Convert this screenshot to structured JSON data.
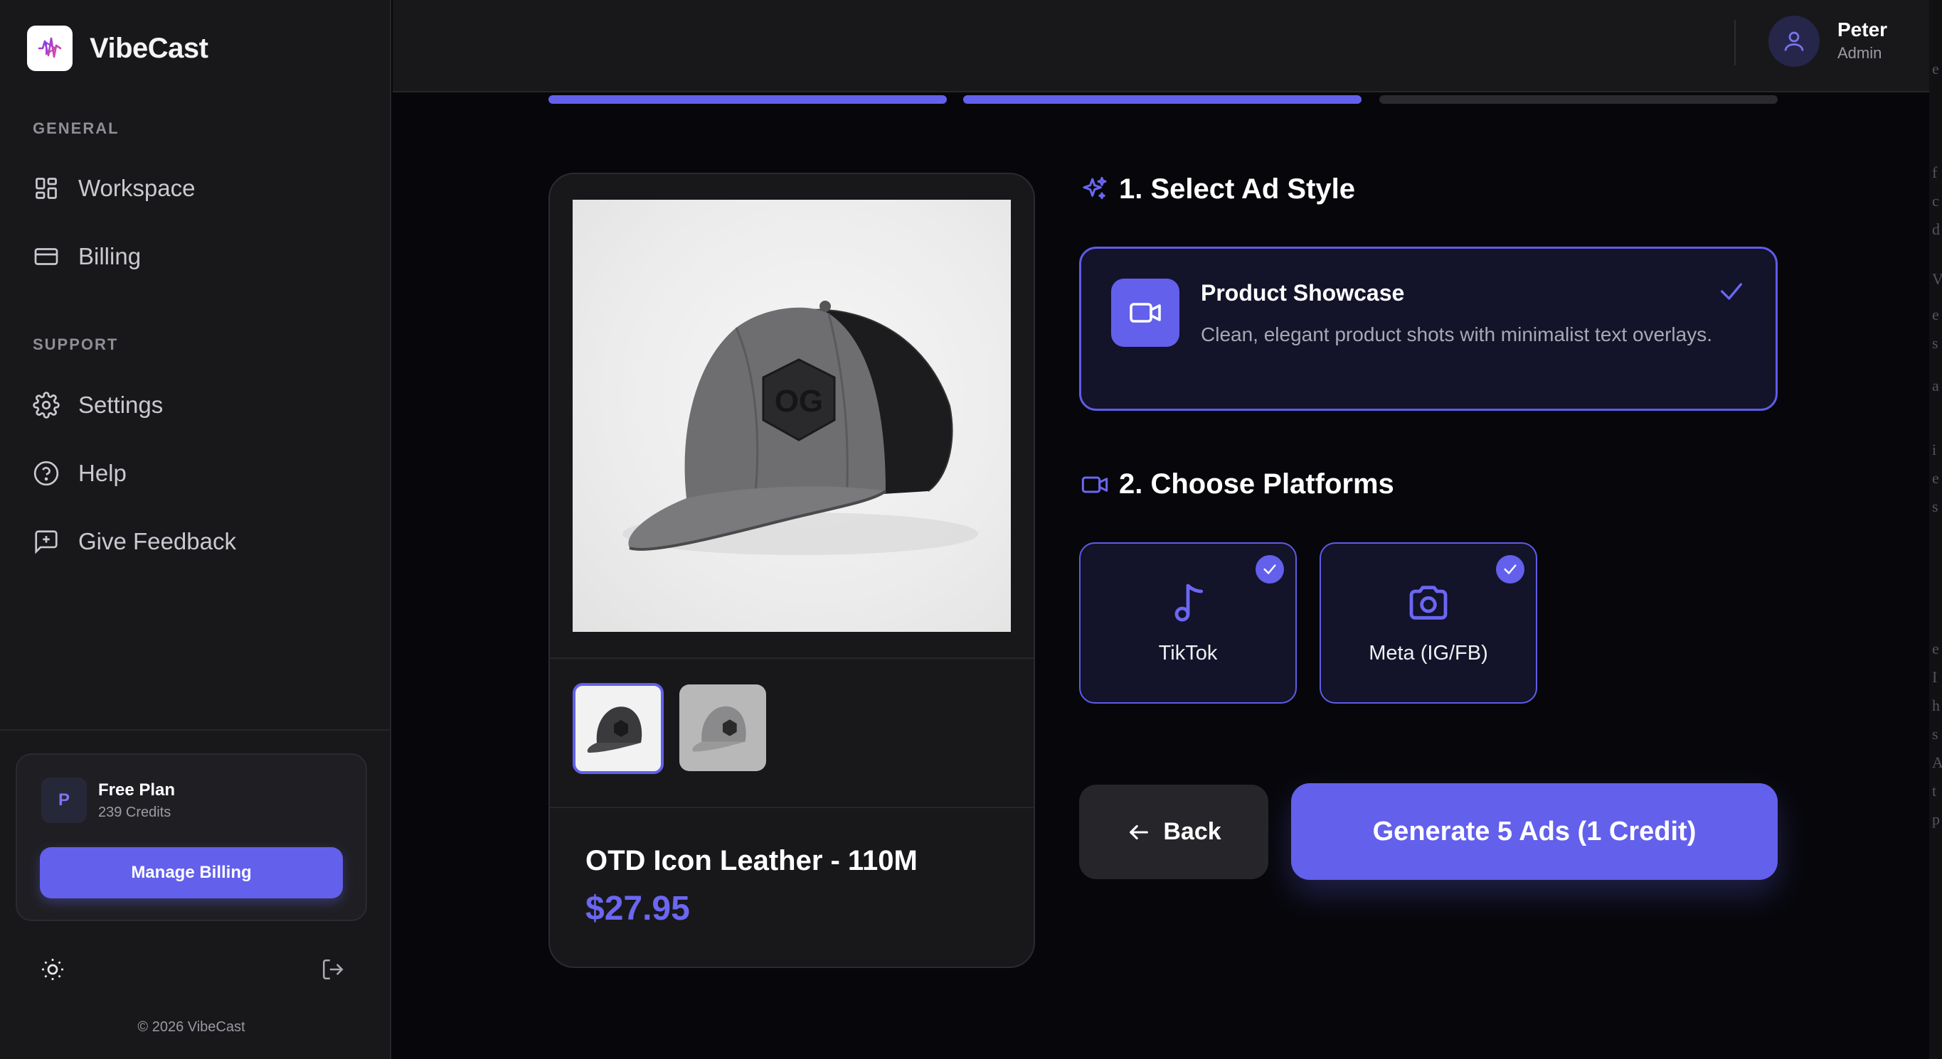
{
  "app": {
    "name": "VibeCast"
  },
  "sidebar": {
    "sections": [
      {
        "label": "GENERAL",
        "items": [
          {
            "label": "Workspace",
            "icon": "grid-icon"
          },
          {
            "label": "Billing",
            "icon": "credit-card-icon"
          }
        ]
      },
      {
        "label": "SUPPORT",
        "items": [
          {
            "label": "Settings",
            "icon": "gear-icon"
          },
          {
            "label": "Help",
            "icon": "help-circle-icon"
          },
          {
            "label": "Give Feedback",
            "icon": "feedback-icon"
          }
        ]
      }
    ],
    "plan": {
      "avatar_letter": "P",
      "name": "Free Plan",
      "credits": "239 Credits",
      "button_label": "Manage Billing"
    },
    "copyright": "© 2026 VibeCast"
  },
  "header": {
    "user": {
      "name": "Peter",
      "role": "Admin"
    }
  },
  "progress": {
    "steps_total": 3,
    "steps_completed": 2
  },
  "product": {
    "name": "OTD Icon Leather - 110M",
    "price": "$27.95",
    "thumbnails": 2,
    "selected_thumbnail": 0
  },
  "ad_style": {
    "section_title": "1. Select Ad Style",
    "selected": {
      "title": "Product Showcase",
      "description": "Clean, elegant product shots with minimalist text overlays.",
      "icon": "video-camera-icon"
    }
  },
  "platforms": {
    "section_title": "2. Choose Platforms",
    "items": [
      {
        "label": "TikTok",
        "icon": "music-note-icon",
        "selected": true
      },
      {
        "label": "Meta (IG/FB)",
        "icon": "camera-icon",
        "selected": true
      }
    ]
  },
  "actions": {
    "back_label": "Back",
    "generate_label": "Generate 5 Ads (1 Credit)"
  },
  "colors": {
    "accent": "#6360ec",
    "background": "#07070b",
    "panel": "#18181b"
  }
}
